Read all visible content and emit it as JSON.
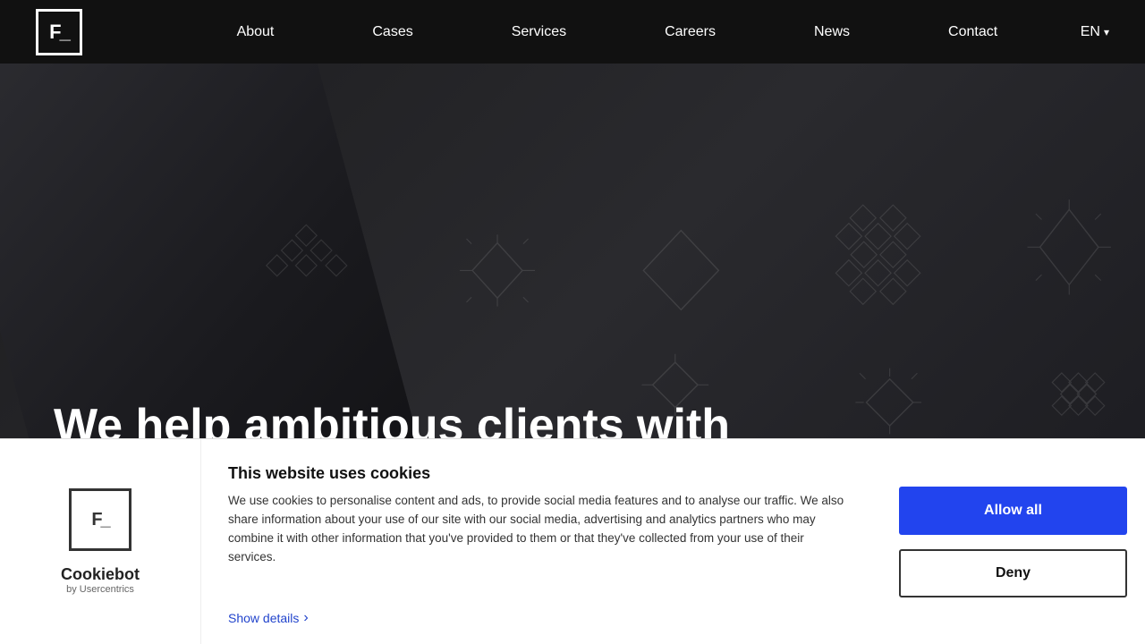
{
  "navbar": {
    "logo_text": "F_",
    "links": [
      {
        "label": "About",
        "href": "#"
      },
      {
        "label": "Cases",
        "href": "#"
      },
      {
        "label": "Services",
        "href": "#"
      },
      {
        "label": "Careers",
        "href": "#"
      },
      {
        "label": "News",
        "href": "#"
      },
      {
        "label": "Contact",
        "href": "#"
      }
    ],
    "language": "EN",
    "language_arrow": "▾"
  },
  "hero": {
    "headline_line1": "We help ambitious clients with"
  },
  "cookie_banner": {
    "logo_text": "F_",
    "title": "This website uses cookies",
    "body": "We use cookies to personalise content and ads, to provide social media features and to analyse our traffic. We also share information about your use of our site with our social media, advertising and analytics partners who may combine it with other information that you've provided to them or that they've collected from your use of their services.",
    "show_details_label": "Show details",
    "allow_label": "Allow all",
    "deny_label": "Deny",
    "cookiebot_name": "Cookiebot",
    "cookiebot_sub": "by Usercentrics"
  }
}
